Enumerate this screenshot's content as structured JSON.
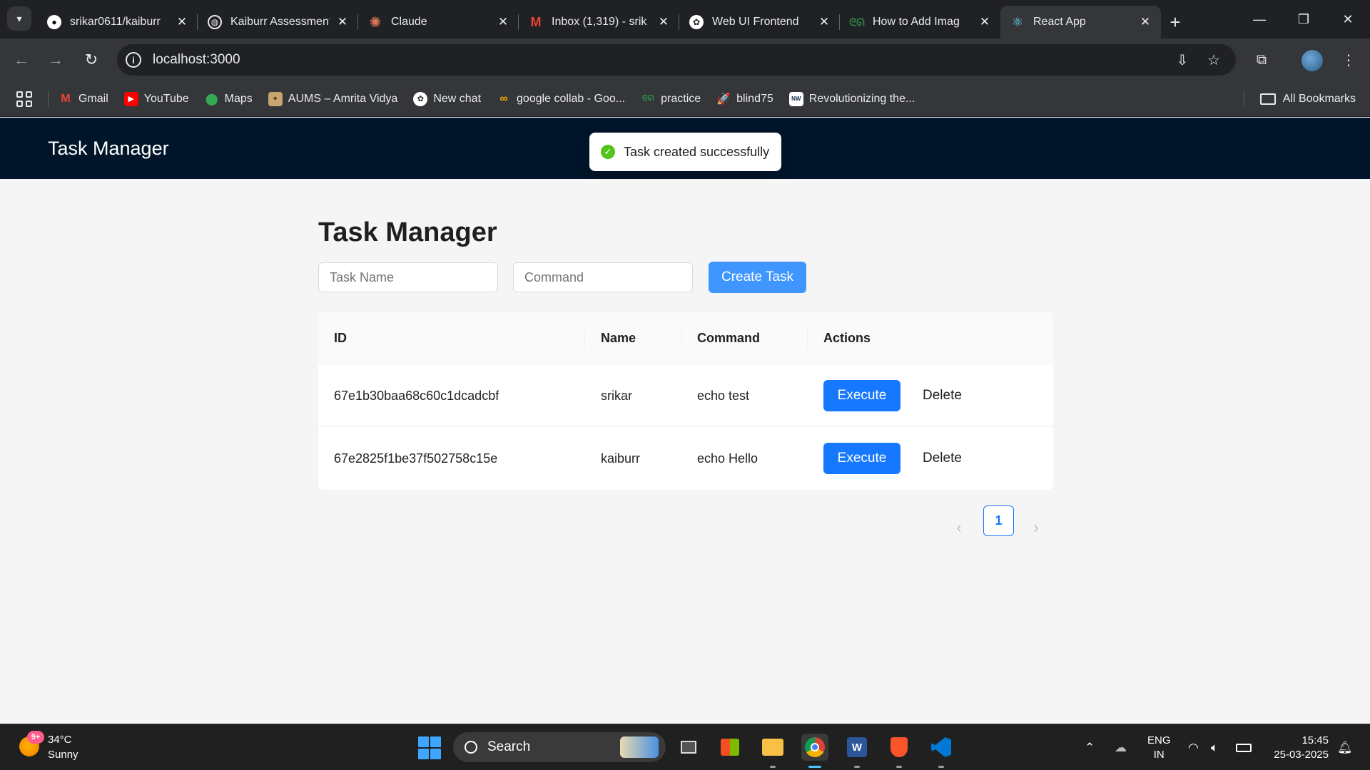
{
  "browser": {
    "tabs": [
      {
        "title": "srikar0611/kaiburr",
        "icon": "github-icon",
        "active": false
      },
      {
        "title": "Kaiburr Assessment",
        "icon": "globe-icon",
        "active": false
      },
      {
        "title": "Claude",
        "icon": "claude-icon",
        "active": false
      },
      {
        "title": "Inbox (1,319) - srik",
        "icon": "gmail-icon",
        "active": false
      },
      {
        "title": "Web UI Frontend",
        "icon": "chatgpt-icon",
        "active": false
      },
      {
        "title": "How to Add Imag",
        "icon": "gfg-icon",
        "active": false
      },
      {
        "title": "React App",
        "icon": "react-icon",
        "active": true
      }
    ],
    "new_tab": "+",
    "address": "localhost:3000",
    "bookmarks": [
      {
        "label": "Gmail",
        "icon": "gmail-icon"
      },
      {
        "label": "YouTube",
        "icon": "youtube-icon"
      },
      {
        "label": "Maps",
        "icon": "maps-icon"
      },
      {
        "label": "AUMS – Amrita Vidya",
        "icon": "aums-icon"
      },
      {
        "label": "New chat",
        "icon": "chatgpt-icon"
      },
      {
        "label": "google collab - Goo...",
        "icon": "colab-icon"
      },
      {
        "label": "practice",
        "icon": "gfg-icon"
      },
      {
        "label": "blind75",
        "icon": "rocket-icon"
      },
      {
        "label": "Revolutionizing the...",
        "icon": "nxtwave-icon"
      }
    ],
    "all_bookmarks": "All Bookmarks"
  },
  "app": {
    "header_title": "Task Manager",
    "toast": "Task created successfully",
    "page_title": "Task Manager",
    "task_name_placeholder": "Task Name",
    "command_placeholder": "Command",
    "create_button": "Create Task",
    "columns": {
      "id": "ID",
      "name": "Name",
      "command": "Command",
      "actions": "Actions"
    },
    "rows": [
      {
        "id": "67e1b30baa68c60c1dcadcbf",
        "name": "srikar",
        "command": "echo test",
        "execute": "Execute",
        "delete": "Delete"
      },
      {
        "id": "67e2825f1be37f502758c15e",
        "name": "kaiburr",
        "command": "echo Hello",
        "execute": "Execute",
        "delete": "Delete"
      }
    ],
    "pagination": {
      "current_page": "1"
    }
  },
  "taskbar": {
    "weather_badge": "9+",
    "temperature": "34°C",
    "weather": "Sunny",
    "search_label": "Search",
    "language": "ENG",
    "region": "IN",
    "time": "15:45",
    "date": "25-03-2025"
  },
  "colors": {
    "header_bg": "#001529",
    "primary": "#1677ff",
    "create_button": "#4096ff",
    "success": "#52c41a"
  }
}
